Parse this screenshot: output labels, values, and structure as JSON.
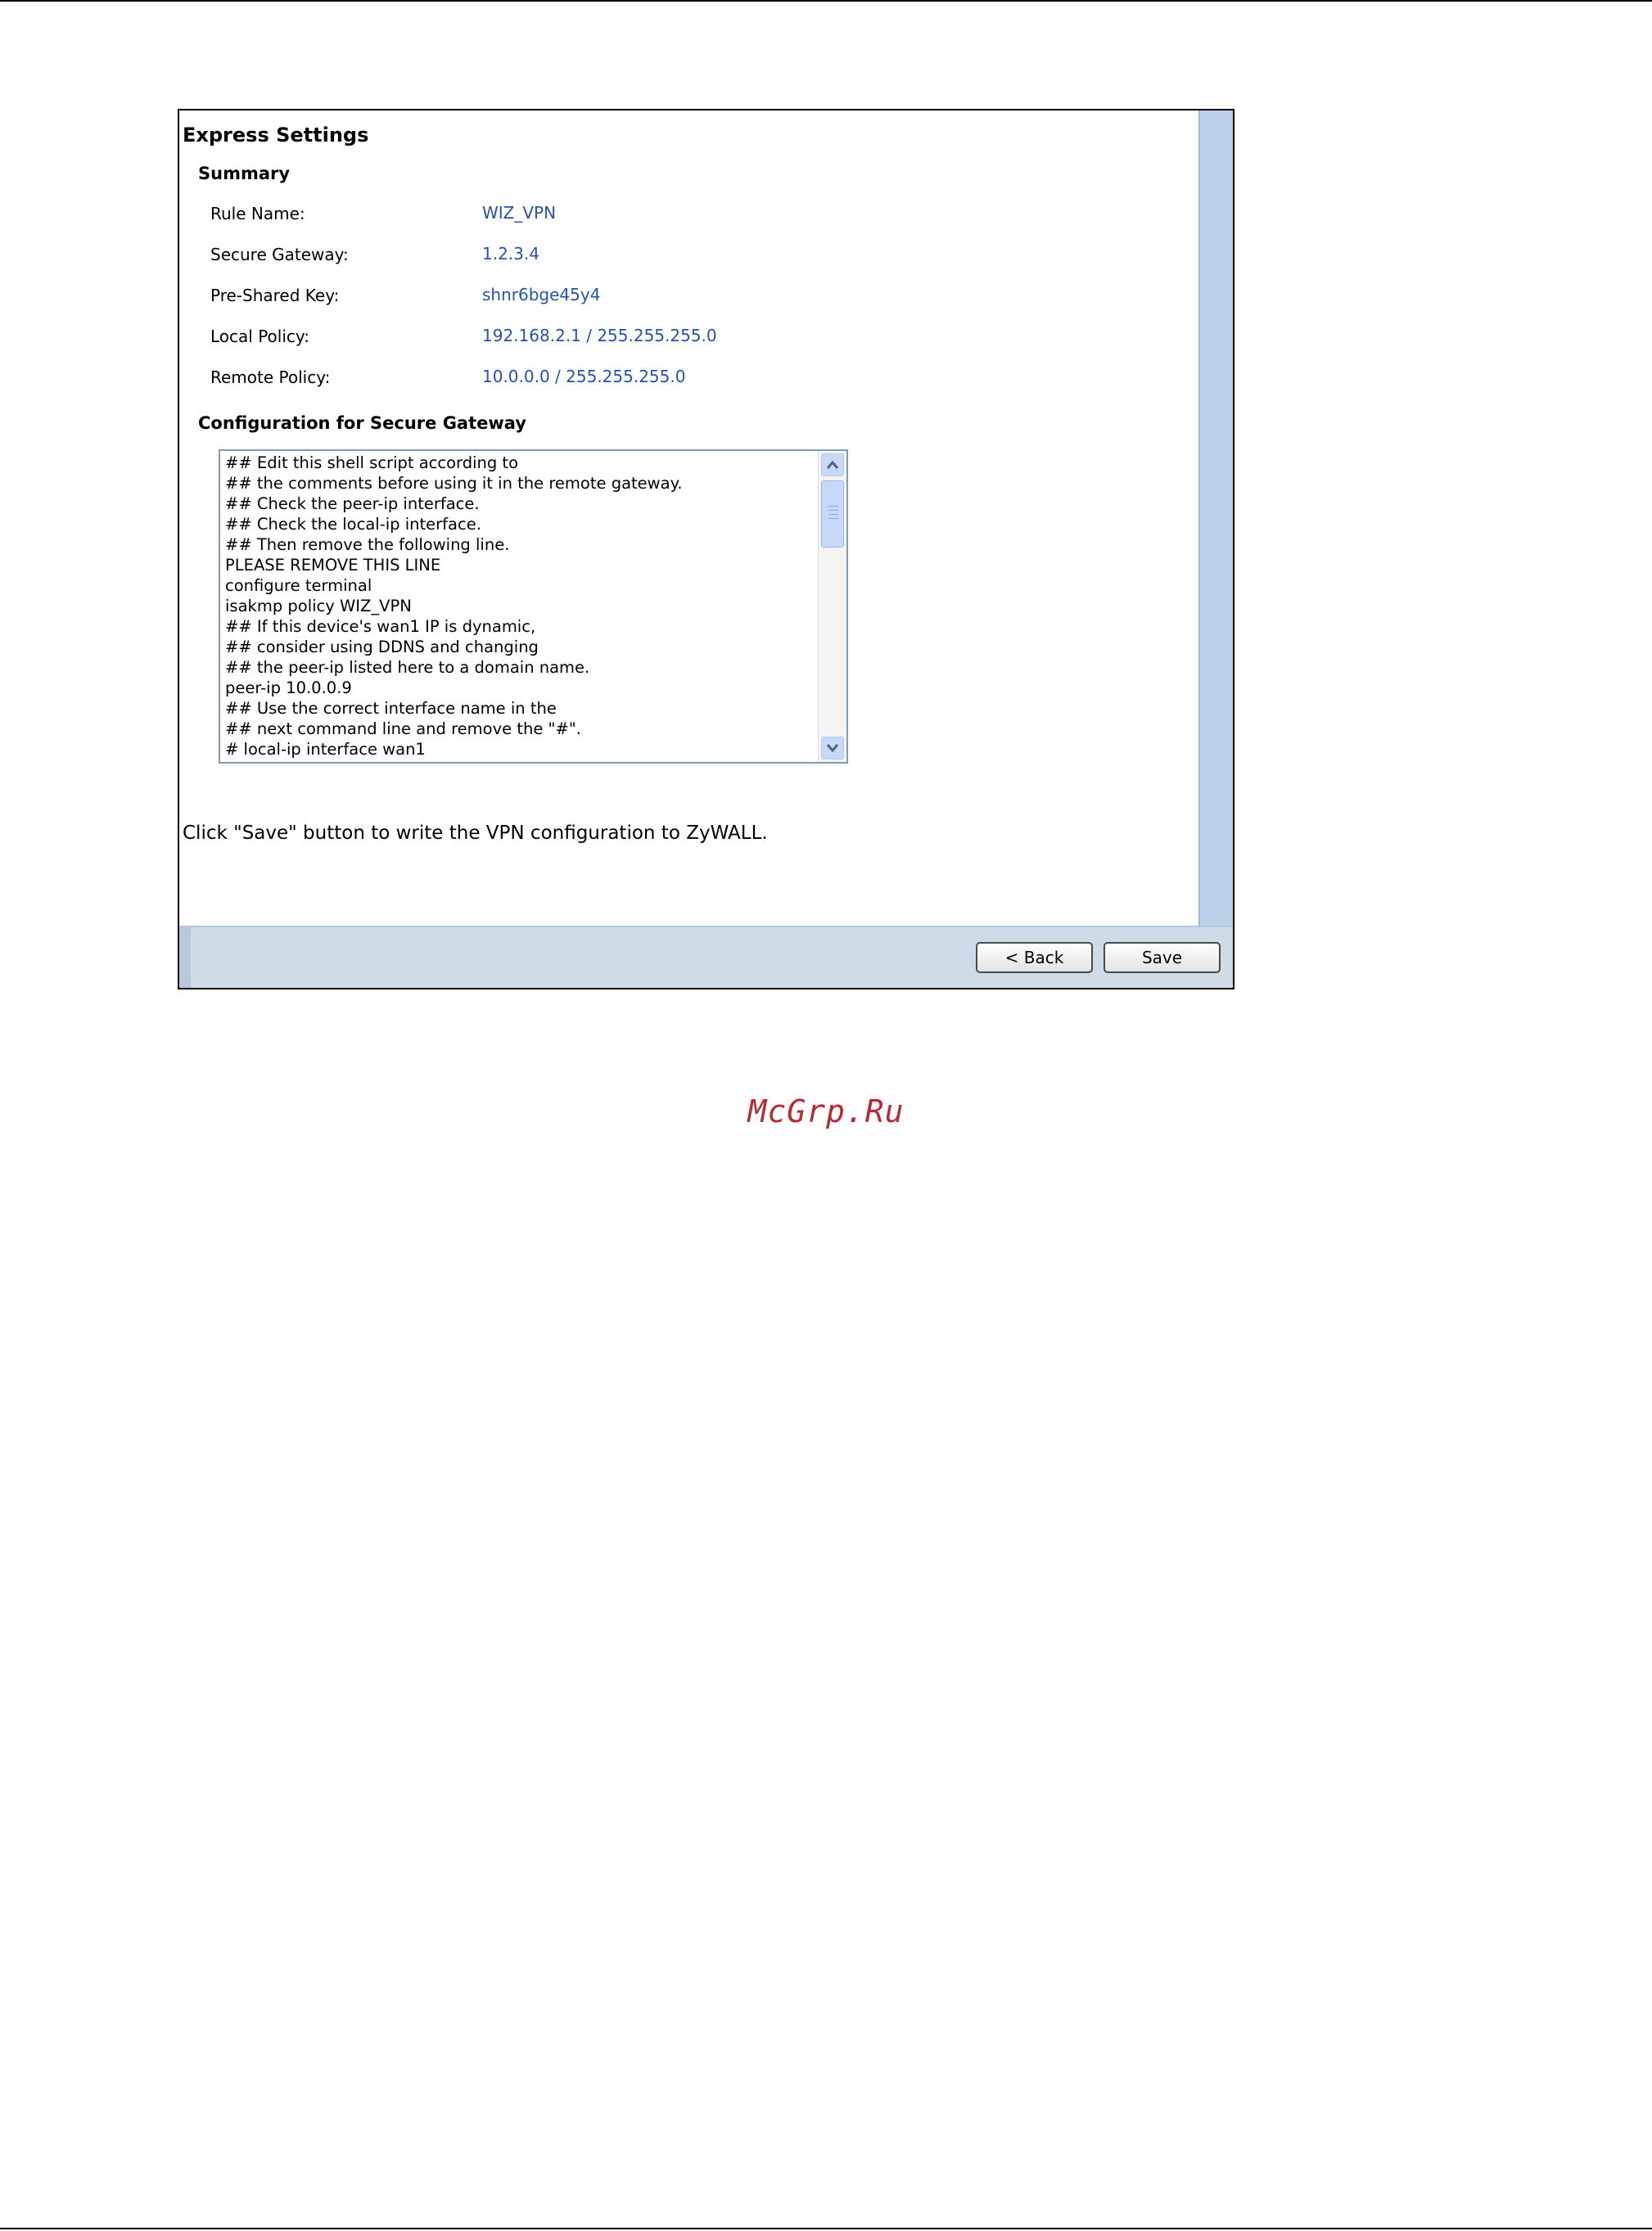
{
  "dialog": {
    "title": "Express Settings",
    "summary": {
      "heading": "Summary",
      "rows": [
        {
          "label": "Rule Name:",
          "value": "WIZ_VPN"
        },
        {
          "label": "Secure Gateway:",
          "value": "1.2.3.4"
        },
        {
          "label": "Pre-Shared Key:",
          "value": "shnr6bge45y4"
        },
        {
          "label": "Local Policy:",
          "value": "192.168.2.1 / 255.255.255.0"
        },
        {
          "label": "Remote Policy:",
          "value": "10.0.0.0 / 255.255.255.0"
        }
      ]
    },
    "config": {
      "heading": "Configuration for Secure Gateway",
      "script": "## Edit this shell script according to\n## the comments before using it in the remote gateway.\n## Check the peer-ip interface.\n## Check the local-ip interface.\n## Then remove the following line.\nPLEASE REMOVE THIS LINE\nconfigure terminal\nisakmp policy WIZ_VPN\n## If this device's wan1 IP is dynamic,\n## consider using DDNS and changing\n## the peer-ip listed here to a domain name.\npeer-ip 10.0.0.9\n## Use the correct interface name in the\n## next command line and remove the \"#\".\n# local-ip interface wan1"
    },
    "note": "Click \"Save\" button to write the VPN configuration to ZyWALL.",
    "buttons": {
      "back": "< Back",
      "save": "Save"
    }
  },
  "icons": {
    "scroll_up": "chevron-up-icon",
    "scroll_down": "chevron-down-icon"
  },
  "watermark": "McGrp.Ru"
}
